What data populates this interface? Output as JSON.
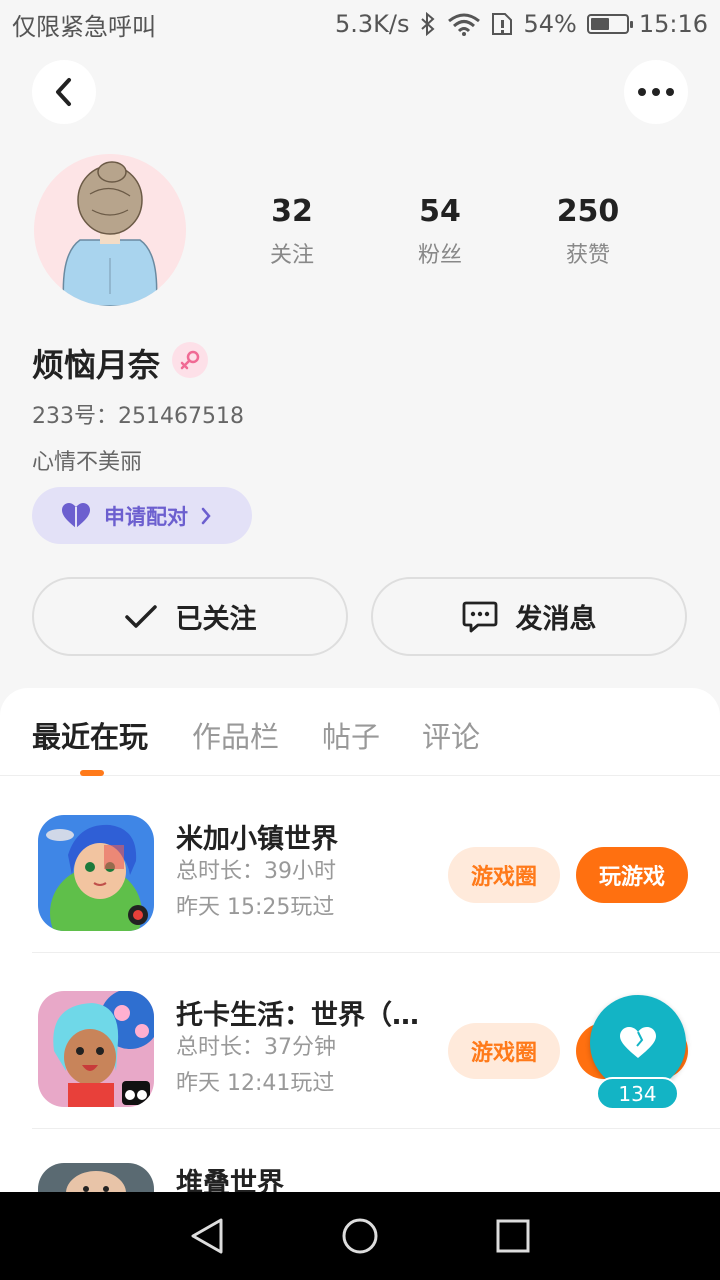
{
  "status_bar": {
    "carrier": "仅限紧急呼叫",
    "net_speed": "5.3K/s",
    "battery": "54%",
    "battery_level": 0.54,
    "time": "15:16"
  },
  "profile": {
    "nickname": "烦恼月奈",
    "uid": "233号：251467518",
    "signature": "心情不美丽",
    "stats": [
      {
        "value": "32",
        "label": "关注"
      },
      {
        "value": "54",
        "label": "粉丝"
      },
      {
        "value": "250",
        "label": "获赞"
      }
    ],
    "pair_label": "申请配对",
    "follow_label": "已关注",
    "message_label": "发消息"
  },
  "tabs": [
    "最近在玩",
    "作品栏",
    "帖子",
    "评论"
  ],
  "active_tab": 0,
  "games": [
    {
      "title": "米加小镇世界",
      "duration": "总时长：39小时",
      "last_played": "昨天 15:25玩过",
      "circle_label": "游戏圈",
      "play_label": "玩游戏"
    },
    {
      "title": "托卡生活：世界（…",
      "duration": "总时长：37分钟",
      "last_played": "昨天 12:41玩过",
      "circle_label": "游戏圈",
      "play_label": "玩游戏"
    },
    {
      "title": "堆叠世界"
    }
  ],
  "floating_like": {
    "count": "134"
  },
  "colors": {
    "accent": "#ff7010",
    "like": "#13b4c5",
    "pair_text": "#6c5fcf"
  },
  "icons": {
    "back": "chevron-left-icon",
    "more": "more-dots-icon",
    "gender": "female-icon",
    "heart": "heart-icon",
    "check": "check-icon",
    "chat": "chat-bubble-icon"
  }
}
